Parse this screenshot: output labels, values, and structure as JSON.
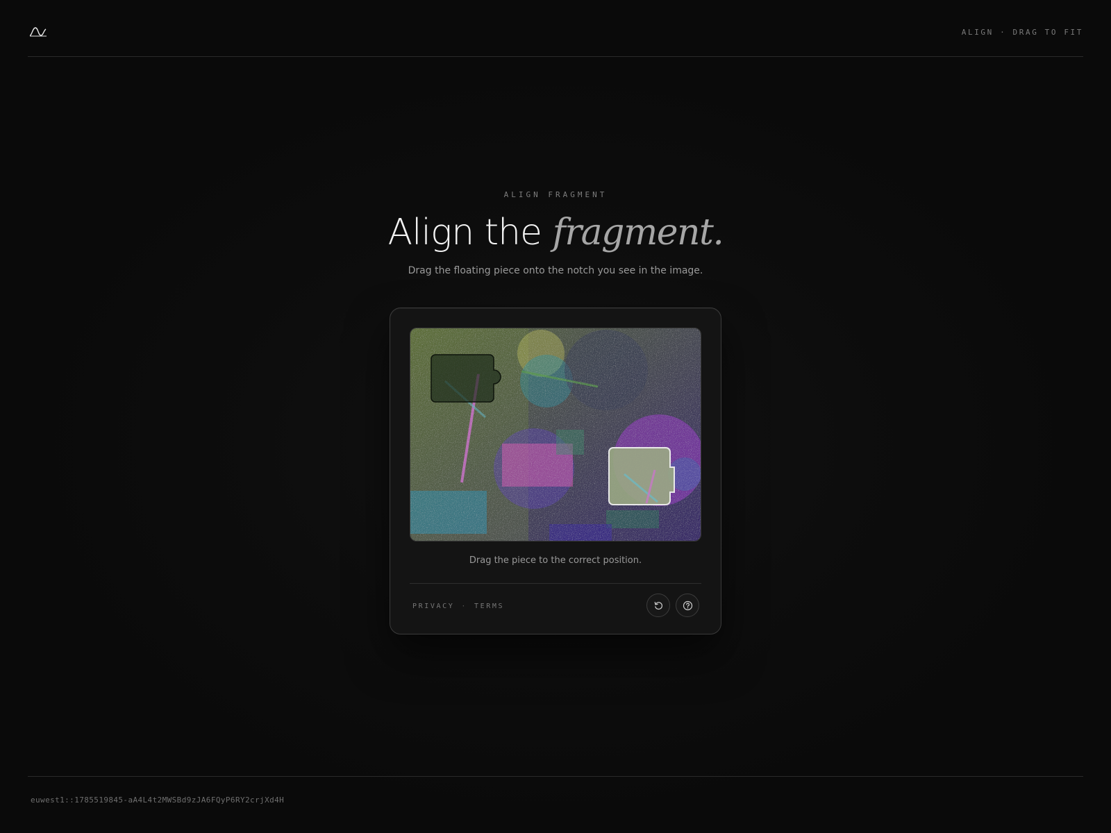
{
  "header": {
    "logo_icon": "wave-logo-icon",
    "status": "ALIGN · DRAG TO FIT"
  },
  "hero": {
    "eyebrow": "ALIGN FRAGMENT",
    "title_plain": "Align the ",
    "title_accent": "fragment.",
    "subtitle": "Drag the floating piece onto the notch you see in the image."
  },
  "puzzle": {
    "hint": "Drag the piece to the correct position.",
    "links": {
      "privacy": "PRIVACY",
      "separator": "·",
      "terms": "TERMS"
    },
    "refresh_icon": "refresh-icon",
    "help_icon": "help-icon"
  },
  "footer": {
    "session_id": "euwest1::1785519845-aA4L4t2MWSBd9zJA6FQyP6RY2crjXd4H"
  },
  "colors": {
    "background": "#0b0b0b",
    "card": "#141414",
    "text_primary": "#f2f2f2",
    "text_muted": "#9a9a9a"
  }
}
